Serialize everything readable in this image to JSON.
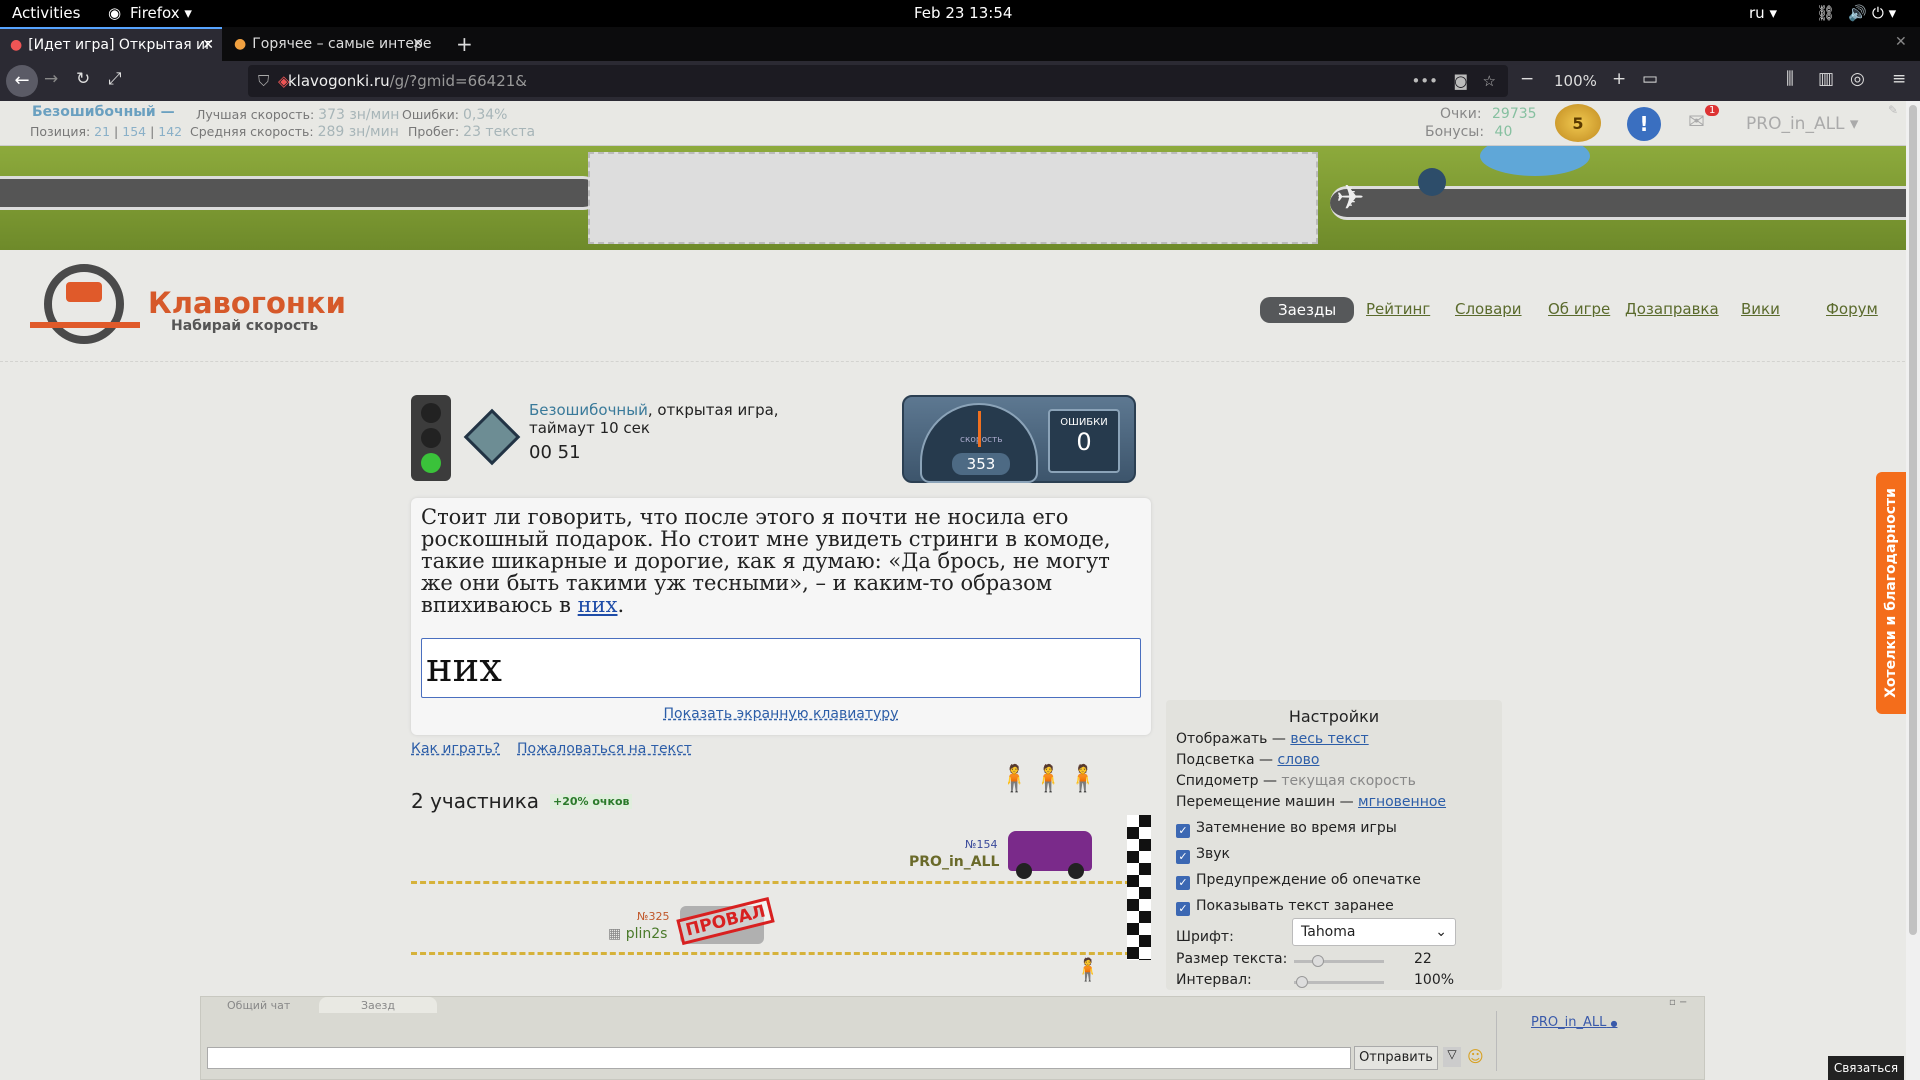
{
  "gnome": {
    "activities": "Activities",
    "app": "Firefox",
    "clock": "Feb 23  13:54",
    "lang": "ru"
  },
  "tabs": [
    {
      "label": "[Идет игра] Открытая иг"
    },
    {
      "label": "Горячее – самые интере"
    }
  ],
  "nav": {
    "url_host": "klavogonki.ru",
    "url_path": "/g/?gmid=66421&",
    "zoom": "100%"
  },
  "userbar": {
    "username": "Безошибочный —",
    "position_label": "Позиция:",
    "position_values": [
      "21",
      "154",
      "142"
    ],
    "best_speed_label": "Лучшая скорость:",
    "best_speed": "373 зн/мин",
    "avg_speed_label": "Средняя скорость:",
    "avg_speed": "289 зн/мин",
    "errors_label": "Ошибки:",
    "errors": "0,34%",
    "mileage_label": "Пробег:",
    "mileage": "23 текста",
    "points_label": "Очки:",
    "points": "29735",
    "bonus_label": "Бонусы:",
    "bonus": "40",
    "level": "5",
    "mail_count": "1",
    "account": "PRO_in_ALL"
  },
  "logo": {
    "title": "Клавогонки",
    "subtitle": "Набирай скорость"
  },
  "menu": [
    "Заезды",
    "Рейтинг",
    "Словари",
    "Об игре",
    "Дозаправка",
    "Вики",
    "Форум"
  ],
  "game": {
    "mode_link": "Безошибочный",
    "mode_rest": ", открытая игра,",
    "timeout": "таймаут 10 сек",
    "timer": "00 51",
    "speed_label": "скорость",
    "speed": "353",
    "errors_label": "ошибки",
    "errors": "0",
    "text_main": "Стоит ли говорить, что после этого я почти не носила его роскошный подарок. Но стоит мне увидеть стринги в комоде, такие шикарные и дорогие, как я думаю: «Да брось, не могут же они быть такими уж тесными», – и каким-то образом впихиваюсь в ",
    "text_word": "них",
    "text_end": ".",
    "input_value": "них",
    "keyboard_link": "Показать экранную клавиатуру",
    "how_to": "Как играть?",
    "report": "Пожаловаться на текст",
    "participants": "2 участника",
    "bonus_badge": "+20% очков"
  },
  "racers": [
    {
      "rank": "№154",
      "name": "PRO_in_ALL"
    },
    {
      "rank": "№325",
      "name": "plin2s",
      "status": "ПРОВАЛ"
    }
  ],
  "settings": {
    "title": "Настройки",
    "display_label": "Отображать —",
    "display_value": "весь текст",
    "highlight_label": "Подсветка —",
    "highlight_value": "слово",
    "speedo_label": "Спидометр —",
    "speedo_value": "текущая скорость",
    "move_label": "Перемещение машин —",
    "move_value": "мгновенное",
    "checkboxes": [
      "Затемнение во время игры",
      "Звук",
      "Предупреждение об опечатке",
      "Показывать текст заранее"
    ],
    "font_label": "Шрифт:",
    "font_value": "Tahoma",
    "size_label": "Размер текста:",
    "size_value": "22",
    "interval_label": "Интервал:",
    "interval_value": "100%"
  },
  "chat": {
    "tab1": "Общий чат",
    "tab2": "Заезд",
    "send": "Отправить",
    "user": "PRO_in_ALL",
    "contact": "Связаться"
  },
  "side_tab": "Хотелки и благодарности"
}
